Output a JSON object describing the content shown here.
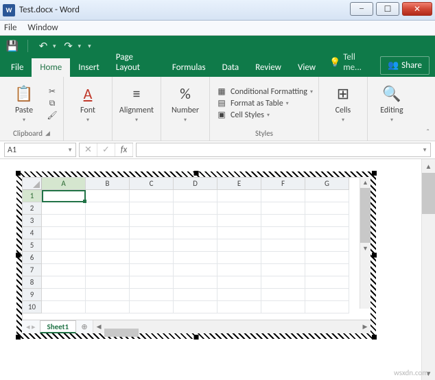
{
  "window": {
    "title": "Test.docx - Word",
    "app_glyph": "W"
  },
  "word_menu": {
    "items": [
      "File",
      "Window"
    ]
  },
  "excel": {
    "tabs": {
      "file": "File",
      "items": [
        "Home",
        "Insert",
        "Page Layout",
        "Formulas",
        "Data",
        "Review",
        "View"
      ],
      "active": "Home",
      "tellme": "Tell me...",
      "share": "Share"
    },
    "ribbon": {
      "clipboard": {
        "paste": "Paste",
        "label": "Clipboard"
      },
      "font": {
        "btn": "Font"
      },
      "alignment": {
        "btn": "Alignment"
      },
      "number": {
        "btn": "Number"
      },
      "styles": {
        "cond": "Conditional Formatting",
        "table": "Format as Table",
        "cell": "Cell Styles",
        "label": "Styles"
      },
      "cells": {
        "btn": "Cells"
      },
      "editing": {
        "btn": "Editing"
      }
    },
    "namebox": "A1",
    "sheet": {
      "columns": [
        "A",
        "B",
        "C",
        "D",
        "E",
        "F",
        "G"
      ],
      "rows": [
        "1",
        "2",
        "3",
        "4",
        "5",
        "6",
        "7",
        "8",
        "9",
        "10"
      ],
      "selected_cell": "A1",
      "tab_label": "Sheet1"
    }
  },
  "watermark": "wsxdn.com"
}
